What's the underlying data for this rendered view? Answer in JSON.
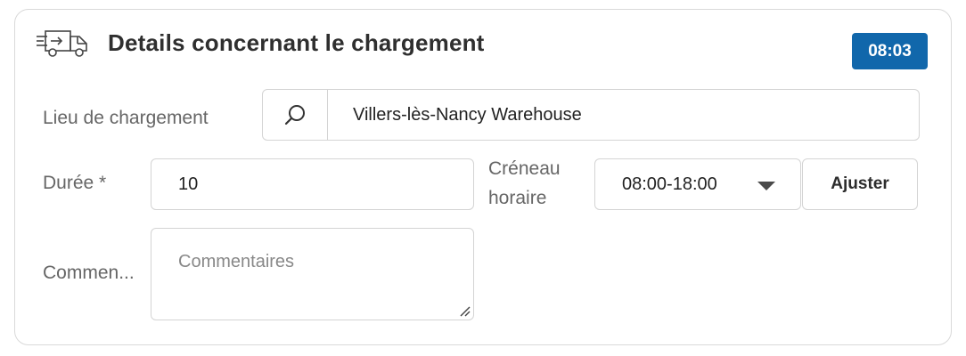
{
  "header": {
    "icon": "delivery-truck-icon",
    "title": "Details concernant le chargement",
    "time_badge": "08:03",
    "badge_color": "#1167ab"
  },
  "form": {
    "loading_place": {
      "label": "Lieu de chargement",
      "search_icon": "search-icon",
      "value": "Villers-lès-Nancy Warehouse"
    },
    "duration": {
      "label": "Durée *",
      "value": "10"
    },
    "time_slot": {
      "label_line1": "Créneau",
      "label_line2": "horaire",
      "value": "08:00-18:00",
      "dropdown_icon": "chevron-down-icon"
    },
    "adjust_button": "Ajuster",
    "comments": {
      "label": "Commen...",
      "placeholder": "Commentaires",
      "value": ""
    }
  }
}
